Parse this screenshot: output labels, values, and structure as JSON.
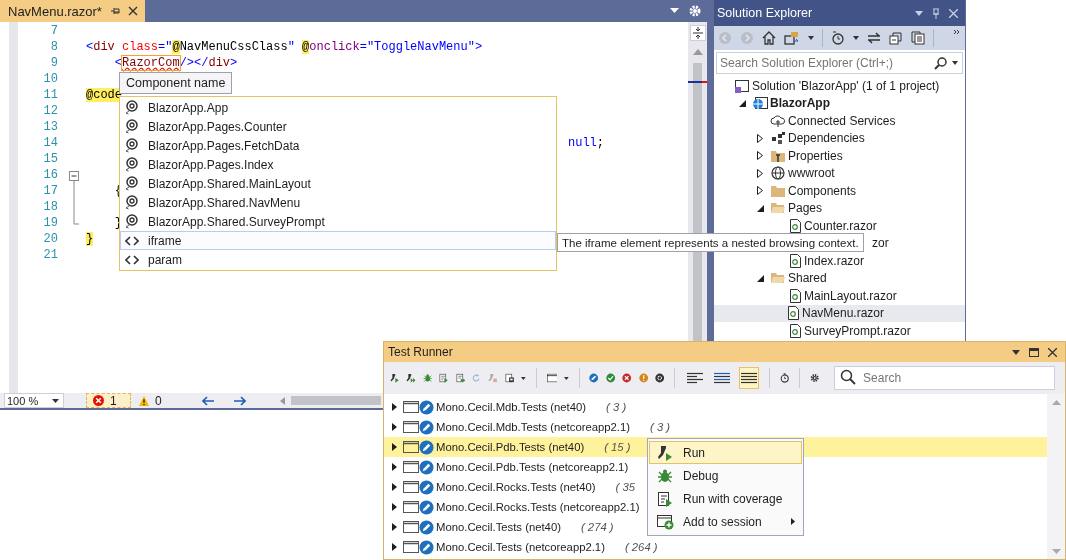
{
  "editor": {
    "tab": {
      "title": "NavMenu.razor*",
      "selected": true
    },
    "lines": [
      {
        "number": "7"
      },
      {
        "number": "8",
        "tokens": [
          {
            "text": "<",
            "kind": "punct"
          },
          {
            "text": "div ",
            "kind": "tag"
          },
          {
            "text": "class",
            "kind": "attr"
          },
          {
            "text": "=\"",
            "kind": "punct"
          },
          {
            "text": "@",
            "kind": "razor"
          },
          {
            "text": "NavMenuCssClass",
            "kind": "plain"
          },
          {
            "text": "\" ",
            "kind": "punct"
          },
          {
            "text": "@",
            "kind": "razor"
          },
          {
            "text": "onclick",
            "kind": "directive"
          },
          {
            "text": "=\"ToggleNavMenu\">",
            "kind": "punct"
          }
        ]
      },
      {
        "number": "9",
        "tokens": [
          {
            "text": "    <",
            "kind": "punct"
          },
          {
            "text": "RazorCom",
            "kind": "error"
          },
          {
            "text": "/>",
            "kind": "punct"
          },
          {
            "text": "</",
            "kind": "punct"
          },
          {
            "text": "div",
            "kind": "tag"
          },
          {
            "text": ">",
            "kind": "punct"
          }
        ]
      },
      {
        "number": "10"
      },
      {
        "number": "11",
        "tokens": [
          {
            "text": "@code",
            "kind": "razor"
          }
        ]
      },
      {
        "number": "12"
      },
      {
        "number": "13"
      },
      {
        "number": "14",
        "tail": [
          {
            "text": "null",
            "kind": "keyword"
          },
          {
            "text": ";",
            "kind": "plain"
          }
        ]
      },
      {
        "number": "15"
      },
      {
        "number": "16",
        "fold": true
      },
      {
        "number": "17",
        "tokens": [
          {
            "text": "    {",
            "kind": "plain"
          }
        ]
      },
      {
        "number": "18"
      },
      {
        "number": "19",
        "tokens": [
          {
            "text": "    }",
            "kind": "plain"
          }
        ]
      },
      {
        "number": "20",
        "tokens": [
          {
            "text": "}",
            "kind": "razor"
          }
        ]
      },
      {
        "number": "21"
      }
    ],
    "hint": "Component name",
    "completion": [
      {
        "label": "BlazorApp.App",
        "kind": "component",
        "selected": false
      },
      {
        "label": "BlazorApp.Pages.Counter",
        "kind": "component",
        "selected": false
      },
      {
        "label": "BlazorApp.Pages.FetchData",
        "kind": "component",
        "selected": false
      },
      {
        "label": "BlazorApp.Pages.Index",
        "kind": "component",
        "selected": false
      },
      {
        "label": "BlazorApp.Shared.MainLayout",
        "kind": "component",
        "selected": false
      },
      {
        "label": "BlazorApp.Shared.NavMenu",
        "kind": "component",
        "selected": false
      },
      {
        "label": "BlazorApp.Shared.SurveyPrompt",
        "kind": "component",
        "selected": false
      },
      {
        "label": "iframe",
        "kind": "element",
        "selected": true
      },
      {
        "label": "param",
        "kind": "element",
        "selected": false
      }
    ],
    "tooltip": "The iframe element represents a nested browsing context.",
    "status": {
      "zoom": "100 %",
      "errors": "1",
      "warnings": "0"
    }
  },
  "solution_explorer": {
    "title": "Solution Explorer",
    "search": {
      "placeholder": "Search Solution Explorer (Ctrl+;)"
    },
    "tree": [
      {
        "label": "Solution 'BlazorApp' (1 of 1 project)",
        "kind": "solution",
        "selected": false,
        "children": [
          {
            "label": "BlazorApp",
            "kind": "project",
            "expanded": true,
            "selected": false,
            "children": [
              {
                "label": "Connected Services",
                "kind": "service",
                "selected": false
              },
              {
                "label": "Dependencies",
                "kind": "dependencies",
                "expanded": false,
                "selected": false
              },
              {
                "label": "Properties",
                "kind": "properties",
                "expanded": false,
                "selected": false
              },
              {
                "label": "wwwroot",
                "kind": "web",
                "expanded": false,
                "selected": false
              },
              {
                "label": "Components",
                "kind": "folder",
                "expanded": false,
                "selected": false
              },
              {
                "label": "Pages",
                "kind": "folder",
                "expanded": true,
                "selected": false,
                "children": [
                  {
                    "label": "Counter.razor",
                    "kind": "file",
                    "selected": false
                  },
                  {
                    "label": "zor",
                    "kind": "file",
                    "obscured": true,
                    "selected": false
                  },
                  {
                    "label": "Index.razor",
                    "kind": "file",
                    "selected": false
                  }
                ]
              },
              {
                "label": "Shared",
                "kind": "folder",
                "expanded": true,
                "selected": false,
                "children": [
                  {
                    "label": "MainLayout.razor",
                    "kind": "file",
                    "selected": false
                  },
                  {
                    "label": "NavMenu.razor",
                    "kind": "file",
                    "selected": true
                  },
                  {
                    "label": "SurveyPrompt.razor",
                    "kind": "file",
                    "selected": false
                  }
                ]
              }
            ]
          }
        ]
      }
    ]
  },
  "test_runner": {
    "title": "Test Runner",
    "search": {
      "placeholder": "Search"
    },
    "view_modes": [
      {
        "selected": false
      },
      {
        "selected": false
      },
      {
        "selected": true
      }
    ],
    "rows": [
      {
        "name": "Mono.Cecil.Mdb.Tests (net40)",
        "count": "( 3 )",
        "selected": false
      },
      {
        "name": "Mono.Cecil.Mdb.Tests (netcoreapp2.1)",
        "count": "( 3 )",
        "selected": false
      },
      {
        "name": "Mono.Cecil.Pdb.Tests (net40)",
        "count": "( 15 )",
        "selected": true
      },
      {
        "name": "Mono.Cecil.Pdb.Tests (netcoreapp2.1)",
        "selected": false
      },
      {
        "name": "Mono.Cecil.Rocks.Tests (net40)",
        "count": "( 35",
        "selected": false
      },
      {
        "name": "Mono.Cecil.Rocks.Tests (netcoreapp2.1)",
        "selected": false
      },
      {
        "name": "Mono.Cecil.Tests (net40)",
        "count": "( 274 )",
        "selected": false
      },
      {
        "name": "Mono.Cecil.Tests (netcoreapp2.1)",
        "count": "( 264 )",
        "selected": false
      }
    ],
    "context_menu": [
      {
        "label": "Run",
        "kind": "run",
        "selected": true
      },
      {
        "label": "Debug",
        "kind": "debug",
        "selected": false
      },
      {
        "label": "Run with coverage",
        "kind": "coverage",
        "selected": false
      },
      {
        "label": "Add to session",
        "kind": "session",
        "selected": false,
        "submenu": true
      }
    ]
  }
}
